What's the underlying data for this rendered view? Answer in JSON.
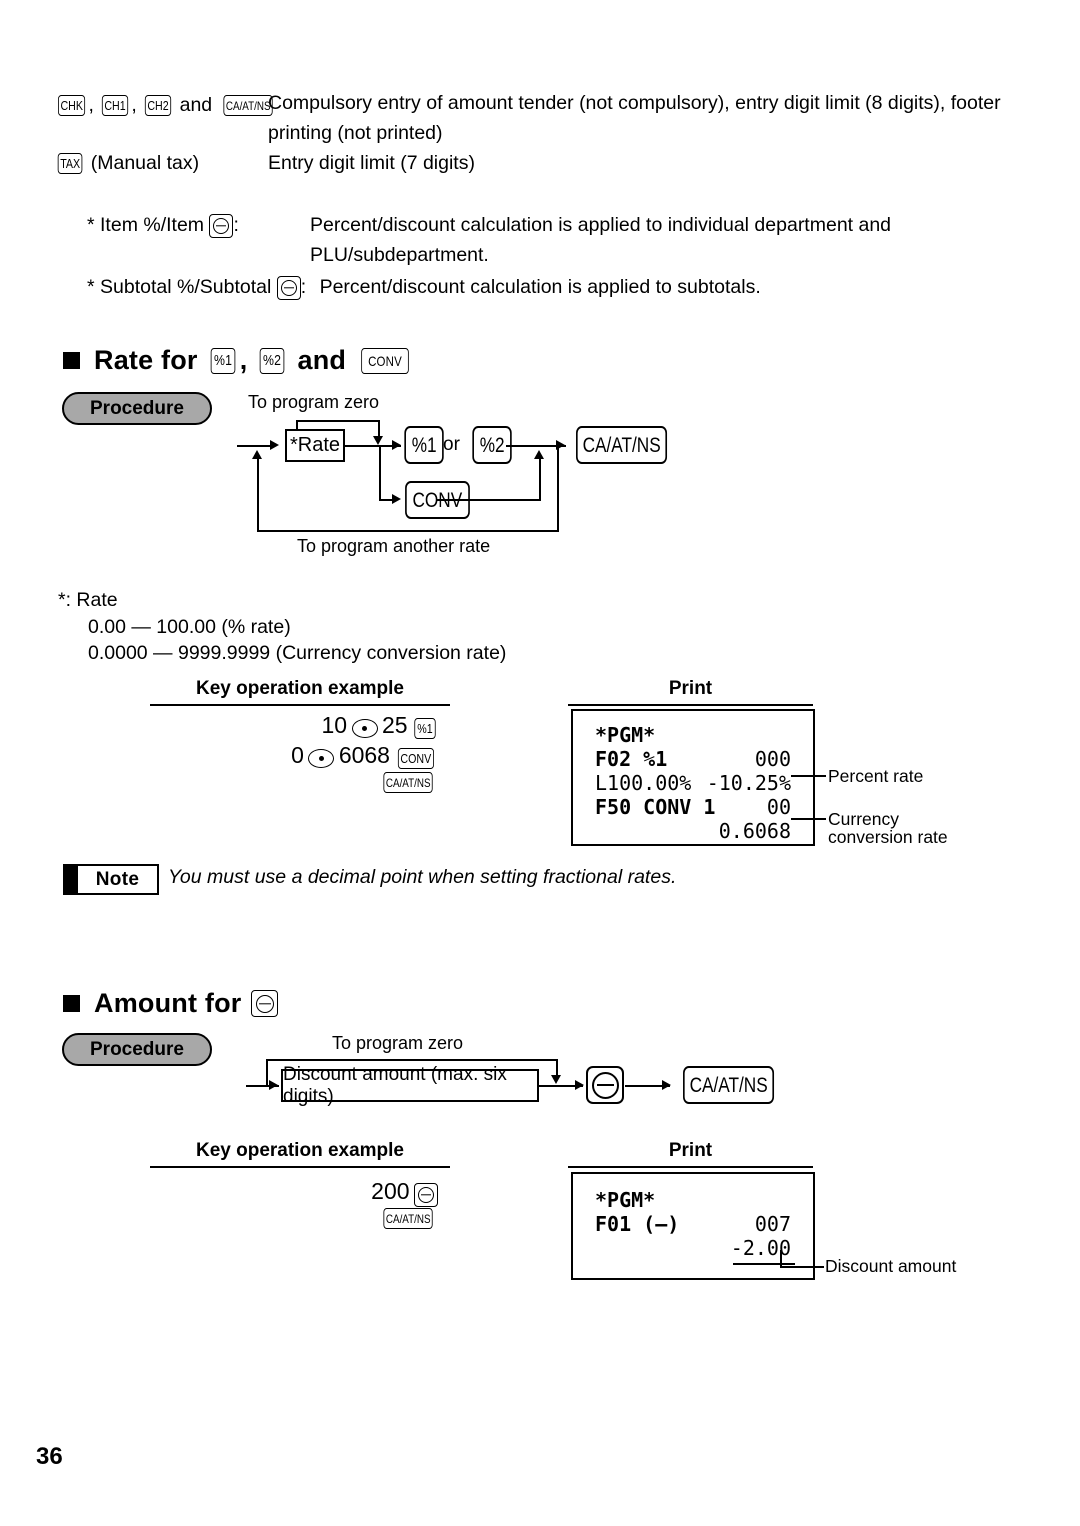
{
  "page": {
    "number": "36"
  },
  "top_spec": {
    "row1": {
      "keys": [
        "CHK",
        "CH1",
        "CH2",
        "CA/AT/NS"
      ],
      "separator1": ",",
      "separator2": ",",
      "conjunction": "and",
      "description_line1": "Compulsory entry of amount tender (not compulsory), entry digit limit (8 digits), footer",
      "description_line2": "printing (not printed)"
    },
    "row2": {
      "key": "TAX",
      "label": "(Manual tax)",
      "description": "Entry digit limit (7 digits)"
    },
    "notes": [
      {
        "marker": "*",
        "label_pre": "Item %/Item",
        "label_post": ":",
        "icon": "minus-circle-icon",
        "text_line1": "Percent/discount calculation is applied to individual department and",
        "text_line2": "PLU/subdepartment."
      },
      {
        "marker": "*",
        "label_pre": "Subtotal %/Subtotal",
        "label_post": ":",
        "icon": "minus-circle-icon",
        "text_line1": "Percent/discount calculation is applied to subtotals.",
        "text_line2": ""
      }
    ]
  },
  "section_rate": {
    "heading_pre": "Rate for",
    "heading_key1": "%1",
    "heading_comma": ",",
    "heading_key2": "%2",
    "heading_and": "and",
    "heading_key3": "CONV",
    "procedure_label": "Procedure",
    "flow": {
      "top_label": "To program zero",
      "bottom_label": "To program another rate",
      "box_rate": "*Rate",
      "key_pct1": "%1",
      "or_label": "or",
      "key_pct2": "%2",
      "key_conv": "CONV",
      "key_finalize": "CA/AT/NS"
    },
    "rate_spec": {
      "title": "*:  Rate",
      "line1": "0.00 — 100.00 (% rate)",
      "line2": "0.0000 — 9999.9999 (Currency conversion rate)"
    },
    "key_operation": {
      "header": "Key operation example",
      "line1": {
        "num1": "10",
        "dot": "decimal-point-key",
        "num2": "25",
        "key": "%1"
      },
      "line2": {
        "num1": "0",
        "dot": "decimal-point-key",
        "num2": "6068",
        "key": "CONV"
      },
      "line3": {
        "key": "CA/AT/NS"
      }
    },
    "print": {
      "header": "Print",
      "lines": [
        {
          "left": "*PGM*",
          "right": "",
          "bold_left": true
        },
        {
          "left": "F02 %1",
          "right": "000",
          "bold_left": true
        },
        {
          "left": "L100.00%",
          "right": "-10.25%",
          "bold_left": false
        },
        {
          "left": "F50 CONV 1",
          "right": "00",
          "bold_left": true
        },
        {
          "left": "",
          "right": "0.6068",
          "bold_left": false
        }
      ],
      "annotations": [
        {
          "text": "Percent rate"
        },
        {
          "text_line1": "Currency",
          "text_line2": "conversion rate"
        }
      ]
    },
    "note": {
      "badge": "Note",
      "text": "You must use a decimal point when setting fractional rates."
    }
  },
  "section_amount": {
    "heading_pre": "Amount for",
    "heading_key": "minus-circle-icon",
    "procedure_label": "Procedure",
    "flow": {
      "top_label": "To program zero",
      "box_discount": "Discount amount (max. six digits)",
      "key_minus": "minus-circle-icon",
      "key_finalize": "CA/AT/NS"
    },
    "key_operation": {
      "header": "Key operation example",
      "line1": {
        "num": "200",
        "key": "minus-circle-icon"
      },
      "line2": {
        "key": "CA/AT/NS"
      }
    },
    "print": {
      "header": "Print",
      "lines": [
        {
          "left": "*PGM*",
          "right": "",
          "bold_left": true
        },
        {
          "left": "F01 (—)",
          "right": "007",
          "bold_left": true
        },
        {
          "left": "",
          "right": "-2.00",
          "bold_left": false
        }
      ],
      "annotations": [
        {
          "text": "Discount amount"
        }
      ]
    }
  },
  "colors": {
    "ink": "#000000",
    "paper": "#ffffff",
    "procedure_fill": "#a8a8a8"
  }
}
